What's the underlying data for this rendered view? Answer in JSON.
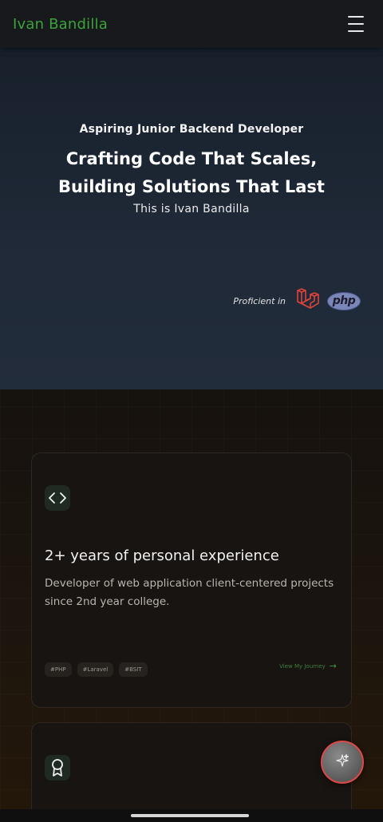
{
  "nav": {
    "brand": "Ivan Bandilla",
    "menu_icon": "hamburger-menu-icon"
  },
  "hero": {
    "kicker": "Aspiring Junior Backend Developer",
    "headline_line1": "Crafting Code That Scales,",
    "headline_line2": "Building Solutions That Last",
    "subtitle": "This is Ivan Bandilla",
    "proficient_label": "Proficient in",
    "laravel_icon": "laravel-logo-icon",
    "php_logo_text": "php"
  },
  "cards": [
    {
      "icon": "code-brackets-icon",
      "title": "2+ years of personal experience",
      "description": "Developer of web application client-centered projects since 2nd year college.",
      "tags": [
        "#PHP",
        "#Laravel",
        "#BSIT"
      ],
      "link_label": "View My Journey"
    },
    {
      "icon": "award-ribbon-icon"
    }
  ],
  "fab": {
    "icon": "sparkle-icon"
  },
  "colors": {
    "brand_green": "#3aa33a",
    "laravel_red": "#e0443a",
    "php_purple": "#7a86b8",
    "fab_border": "#e04848"
  }
}
